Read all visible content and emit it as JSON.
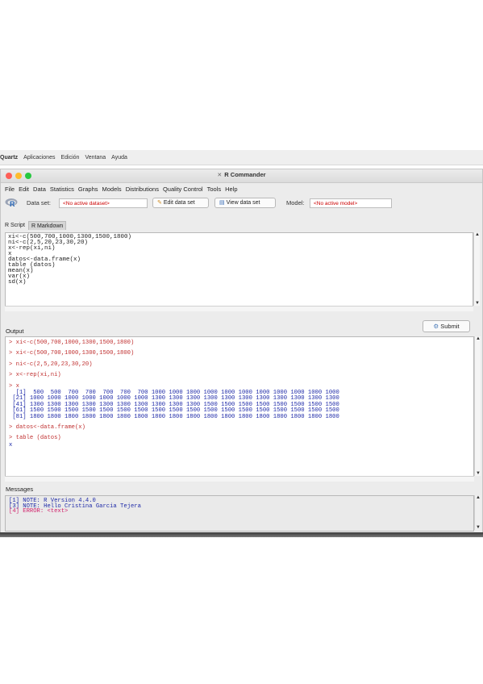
{
  "menubar": {
    "items": [
      "Quartz",
      "Aplicaciones",
      "Edición",
      "Ventana",
      "Ayuda"
    ]
  },
  "window": {
    "title": "R Commander",
    "title_icon": "x-window-icon",
    "traffic_light_colors": [
      "#fe5f57",
      "#febc2e",
      "#28c840"
    ]
  },
  "app_menu": [
    "File",
    "Edit",
    "Data",
    "Statistics",
    "Graphs",
    "Models",
    "Distributions",
    "Quality Control",
    "Tools",
    "Help"
  ],
  "toolbar": {
    "logo_text": "R",
    "dataset_label": "Data set:",
    "dataset_value": "<No active dataset>",
    "edit_label": "Edit data set",
    "view_label": "View data set",
    "model_label": "Model:",
    "model_value": "<No active model>",
    "accent_red": "#cc0000"
  },
  "tabs": [
    "R Script",
    "R Markdown"
  ],
  "script_lines": [
    "xi<-c(500,700,1000,1300,1500,1800)",
    "ni<-c(2,5,20,23,30,20)",
    "x<-rep(xi,ni)",
    "x",
    "datos<-data.frame(x)",
    "table (datos)",
    "mean(x)",
    "var(x)",
    "sd(x)"
  ],
  "output": {
    "label": "Output",
    "submit_label": "Submit",
    "blocks": [
      {
        "cmd": "> xi<-c(500,700,1000,1300,1500,1800)",
        "res": []
      },
      {
        "cmd": "> xi<-c(500,700,1000,1300,1500,1800)",
        "res": []
      },
      {
        "cmd": "> ni<-c(2,5,20,23,30,20)",
        "res": []
      },
      {
        "cmd": "> x<-rep(xi,ni)",
        "res": []
      },
      {
        "cmd": "> x",
        "res": [
          "  [1]  500  500  700  700  700  700  700 1000 1000 1000 1000 1000 1000 1000 1000 1000 1000 1000",
          " [21] 1000 1000 1000 1000 1000 1000 1000 1300 1300 1300 1300 1300 1300 1300 1300 1300 1300 1300",
          " [41] 1300 1300 1300 1300 1300 1300 1300 1300 1300 1300 1500 1500 1500 1500 1500 1500 1500 1500",
          " [61] 1500 1500 1500 1500 1500 1500 1500 1500 1500 1500 1500 1500 1500 1500 1500 1500 1500 1500",
          " [81] 1800 1800 1800 1800 1800 1800 1800 1800 1800 1800 1800 1800 1800 1800 1800 1800 1800 1800"
        ]
      },
      {
        "cmd": "> datos<-data.frame(x)",
        "res": []
      },
      {
        "cmd": "> table (datos)",
        "res": [
          "x"
        ]
      }
    ]
  },
  "messages": {
    "label": "Messages",
    "lines": [
      {
        "type": "note",
        "text": "[1] NOTE: R Version 4.4.0"
      },
      {
        "type": "note",
        "text": "[3] NOTE: Hello Cristina Garcia Tejera"
      },
      {
        "type": "error",
        "text": "[4] ERROR: <text>"
      }
    ]
  }
}
